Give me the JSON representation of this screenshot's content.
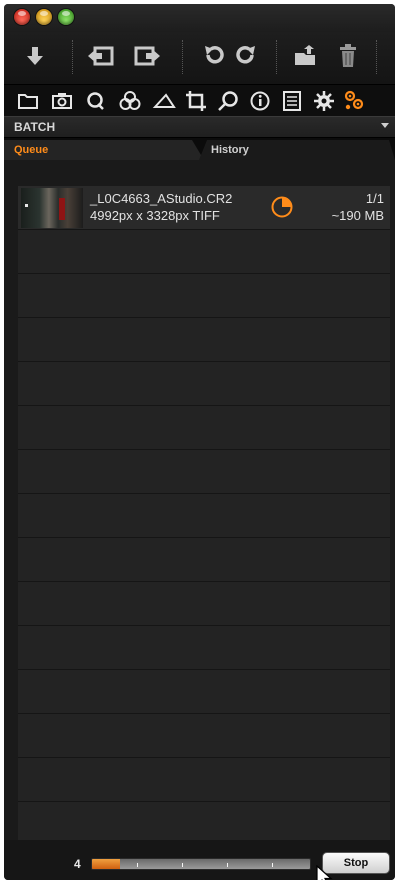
{
  "window": {
    "title_buttons": [
      "close",
      "minimize",
      "zoom"
    ]
  },
  "toolbar": {
    "items": [
      {
        "name": "import-icon"
      },
      {
        "name": "previous-image-icon"
      },
      {
        "name": "next-image-icon"
      },
      {
        "name": "rotate-left-icon"
      },
      {
        "name": "rotate-right-icon"
      },
      {
        "name": "move-to-folder-icon"
      },
      {
        "name": "trash-icon"
      }
    ]
  },
  "tool_tabs": {
    "items": [
      {
        "name": "library-tab"
      },
      {
        "name": "capture-tab"
      },
      {
        "name": "quick-tab"
      },
      {
        "name": "color-tab"
      },
      {
        "name": "exposure-tab"
      },
      {
        "name": "crop-tab"
      },
      {
        "name": "focus-tab"
      },
      {
        "name": "metadata-tab"
      },
      {
        "name": "output-tab"
      },
      {
        "name": "adjustments-tab"
      },
      {
        "name": "batch-tab"
      }
    ],
    "active": "batch-tab"
  },
  "batch": {
    "title": "BATCH"
  },
  "tabs": {
    "queue": "Queue",
    "history": "History",
    "active": "Queue"
  },
  "queue": {
    "items": [
      {
        "filename": "_L0C4663_AStudio.CR2",
        "dimensions": "4992px x 3328px TIFF",
        "count": "1/1",
        "size": "~190 MB"
      }
    ],
    "empty_rows": 14
  },
  "footer": {
    "remaining": "4",
    "progress": 0.13,
    "stop_label": "Stop"
  },
  "colors": {
    "accent": "#ff8c1a",
    "background": "#161616",
    "row": "#232323"
  }
}
